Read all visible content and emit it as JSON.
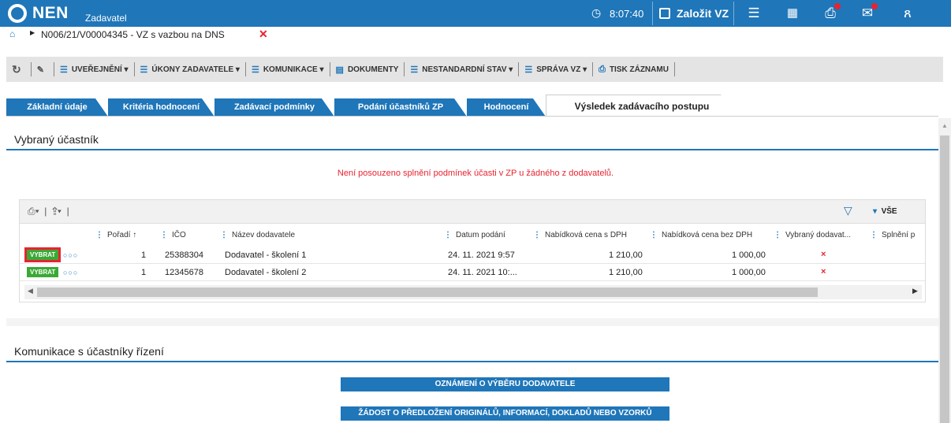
{
  "header": {
    "brand": "NEN",
    "subtitle": "Zadavatel",
    "time": "8:07:40",
    "create_label": "Založit VZ"
  },
  "breadcrumb": {
    "text": "N006/21/V00004345 - VZ s vazbou na DNS"
  },
  "toolbar": {
    "items": [
      "UVEŘEJNĚNÍ",
      "ÚKONY ZADAVATELE",
      "KOMUNIKACE",
      "DOKUMENTY",
      "NESTANDARDNÍ STAV",
      "SPRÁVA VZ",
      "TISK ZÁZNAMU"
    ]
  },
  "tabs": [
    "Základní údaje",
    "Kritéria hodnocení",
    "Zadávací podmínky",
    "Podání účastníků ZP",
    "Hodnocení",
    "Výsledek zadávacího postupu"
  ],
  "active_tab": "Výsledek zadávacího postupu",
  "section1": {
    "title": "Vybraný účastník",
    "warning": "Není posouzeno splnění podmínek účasti v ZP u žádného z dodavatelů."
  },
  "grid": {
    "filter_label": "VŠE",
    "columns": [
      "Pořadí ↑",
      "IČO",
      "Název dodavatele",
      "Datum podání",
      "Nabídková cena s DPH",
      "Nabídková cena bez DPH",
      "Vybraný dodavat...",
      "Splnění p"
    ],
    "rows": [
      {
        "action": "VYBRAT",
        "poradi": "1",
        "ico": "25388304",
        "nazev": "Dodavatel - školení 1",
        "datum": "24. 11. 2021 9:57",
        "cena_s": "1 210,00",
        "cena_bez": "1 000,00",
        "vybrany": "×"
      },
      {
        "action": "VYBRAT",
        "poradi": "1",
        "ico": "12345678",
        "nazev": "Dodavatel - školení 2",
        "datum": "24. 11. 2021 10:...",
        "cena_s": "1 210,00",
        "cena_bez": "1 000,00",
        "vybrany": "×"
      }
    ]
  },
  "section2": {
    "title": "Komunikace s účastníky řízení",
    "buttons": [
      "OZNÁMENÍ O VÝBĚRU DODAVATELE",
      "ŽÁDOST O PŘEDLOŽENÍ ORIGINÁLŮ, INFORMACÍ, DOKLADŮ NEBO VZORKŮ"
    ]
  },
  "colors": {
    "primary": "#1f76b9",
    "danger": "#e8232f",
    "success": "#3aa935"
  }
}
